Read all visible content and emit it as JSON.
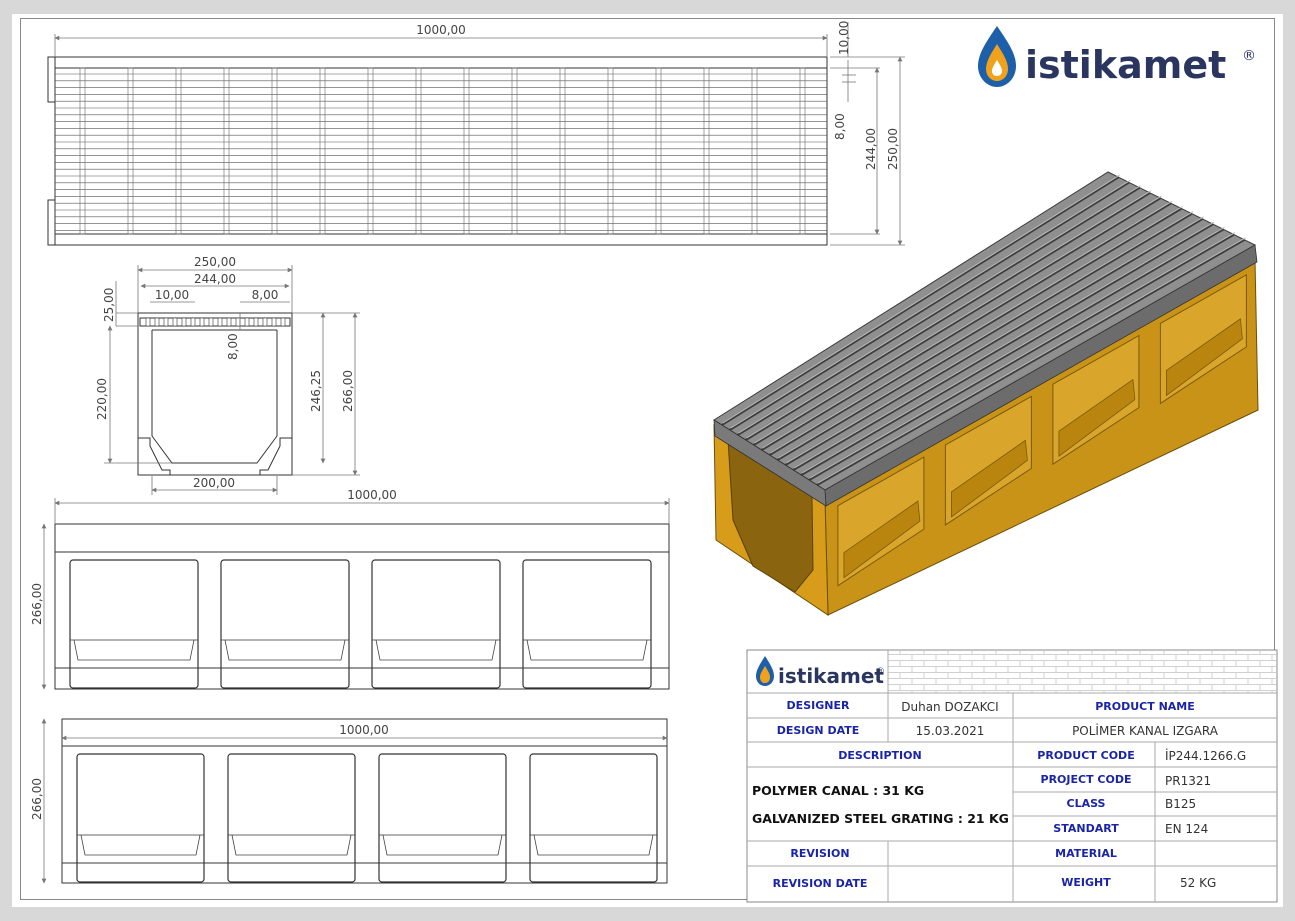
{
  "brand": {
    "name": "istikamet",
    "registered_mark": "®",
    "colors": {
      "drop_blue": "#1d5fa8",
      "drop_orange": "#f0a21c",
      "text": "#2a3560"
    }
  },
  "views": {
    "top": {
      "length": "1000,00",
      "rail": "10,00",
      "gap": "8,00",
      "inner_width": "244,00",
      "outer_width": "250,00"
    },
    "section": {
      "outer_width": "250,00",
      "inner_width": "244,00",
      "bar_width": "10,00",
      "gap_width": "8,00",
      "grate_height": "25,00",
      "slot_depth": "8,00",
      "channel_depth": "220,00",
      "inner_height": "246,25",
      "total_height": "266,00",
      "base_width": "200,00"
    },
    "side1": {
      "length": "1000,00",
      "height": "266,00"
    },
    "side2": {
      "length": "1000,00",
      "height": "266,00"
    }
  },
  "title_block": {
    "designer_label": "DESIGNER",
    "designer_value": "Duhan DOZAKCI",
    "design_date_label": "DESIGN DATE",
    "design_date_value": "15.03.2021",
    "product_name_label": "PRODUCT NAME",
    "product_name_value": "POLİMER KANAL IZGARA",
    "description_label": "DESCRIPTION",
    "description_line1": "POLYMER CANAL : 31 KG",
    "description_line2": "GALVANIZED STEEL GRATING : 21 KG",
    "product_code_label": "PRODUCT CODE",
    "product_code_value": "İP244.1266.G",
    "project_code_label": "PROJECT CODE",
    "project_code_value": "PR1321",
    "class_label": "CLASS",
    "class_value": "B125",
    "standart_label": "STANDART",
    "standart_value": "EN 124",
    "revision_label": "REVISION",
    "revision_date_label": "REVISION DATE",
    "material_label": "MATERIAL",
    "weight_label": "WEIGHT",
    "weight_value": "52 KG"
  }
}
